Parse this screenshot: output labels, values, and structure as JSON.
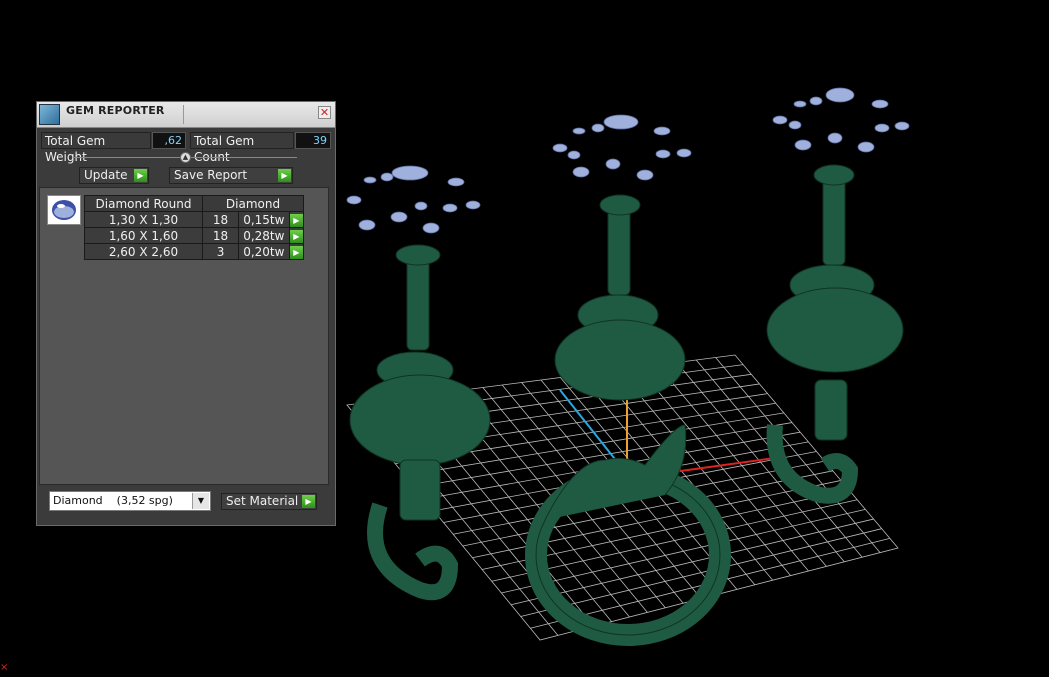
{
  "panel": {
    "title": "GEM REPORTER",
    "close_glyph": "✕",
    "total_weight_label": "Total Gem Weight",
    "total_weight_value": ",62",
    "total_count_label": "Total Gem Count",
    "total_count_value": "39",
    "update_label": "Update",
    "save_report_label": "Save Report",
    "table_header_shape": "Diamond Round",
    "table_header_material": "Diamond",
    "rows": [
      {
        "size": "1,30 X 1,30",
        "count": "18",
        "weight": "0,15tw"
      },
      {
        "size": "1,60 X 1,60",
        "count": "18",
        "weight": "0,28tw"
      },
      {
        "size": "2,60 X 2,60",
        "count": "3",
        "weight": "0,20tw"
      }
    ],
    "material_select_value": "Diamond    (3,52 spg)",
    "set_material_label": "Set Material"
  },
  "icons": {
    "app_icon": "gem-reporter-icon",
    "arrow": "▶",
    "dropdown": "▼"
  },
  "colors": {
    "background": "#000000",
    "model": "#1f5b43",
    "gems": "#9fb0dd",
    "value_text": "#7fd3ff"
  }
}
